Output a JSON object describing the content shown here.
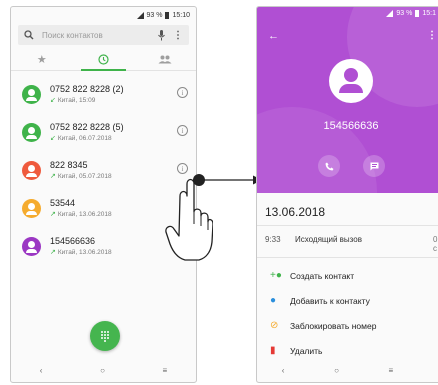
{
  "left": {
    "status": {
      "battery": "93 %",
      "time": "15:10"
    },
    "search_placeholder": "Поиск контактов",
    "icons": {
      "search": "magnifier",
      "mic": "microphone",
      "menu": "more-vertical",
      "favorites_tab": "star",
      "recents_tab": "clock",
      "contacts_tab": "people"
    },
    "calls": [
      {
        "number": "0752 822 8228 (2)",
        "detail": "Китай, 15:09",
        "direction": "incoming",
        "color": "#3fb34a"
      },
      {
        "number": "0752 822 8228 (5)",
        "detail": "Китай, 06.07.2018",
        "direction": "incoming",
        "color": "#3fb34a"
      },
      {
        "number": "822 8345",
        "detail": "Китай, 05.07.2018",
        "direction": "outgoing",
        "color": "#ef5a3d"
      },
      {
        "number": "53544",
        "detail": "Китай, 13.06.2018",
        "direction": "outgoing",
        "color": "#f5ab2e"
      },
      {
        "number": "154566636",
        "detail": "Китай, 13.06.2018",
        "direction": "outgoing",
        "color": "#9b37c3"
      }
    ],
    "nav": {
      "back": "‹",
      "home": "○",
      "recents": "≡"
    }
  },
  "right": {
    "status": {
      "battery": "93 %",
      "time": "15:1"
    },
    "contact_name": "154566636",
    "hero_color": "#b04fd3",
    "date": "13.06.2018",
    "call": {
      "time": "9:33",
      "type": "Исходящий вызов",
      "duration": "0 с"
    },
    "actions": [
      {
        "label": "Создать контакт",
        "icon": "add-person",
        "color": "#3fb34a"
      },
      {
        "label": "Добавить к контакту",
        "icon": "person",
        "color": "#2b8fdc"
      },
      {
        "label": "Заблокировать номер",
        "icon": "block",
        "color": "#f5ab2e"
      },
      {
        "label": "Удалить",
        "icon": "trash",
        "color": "#e53935"
      }
    ],
    "nav": {
      "back": "‹",
      "home": "○",
      "recents": "≡"
    }
  }
}
